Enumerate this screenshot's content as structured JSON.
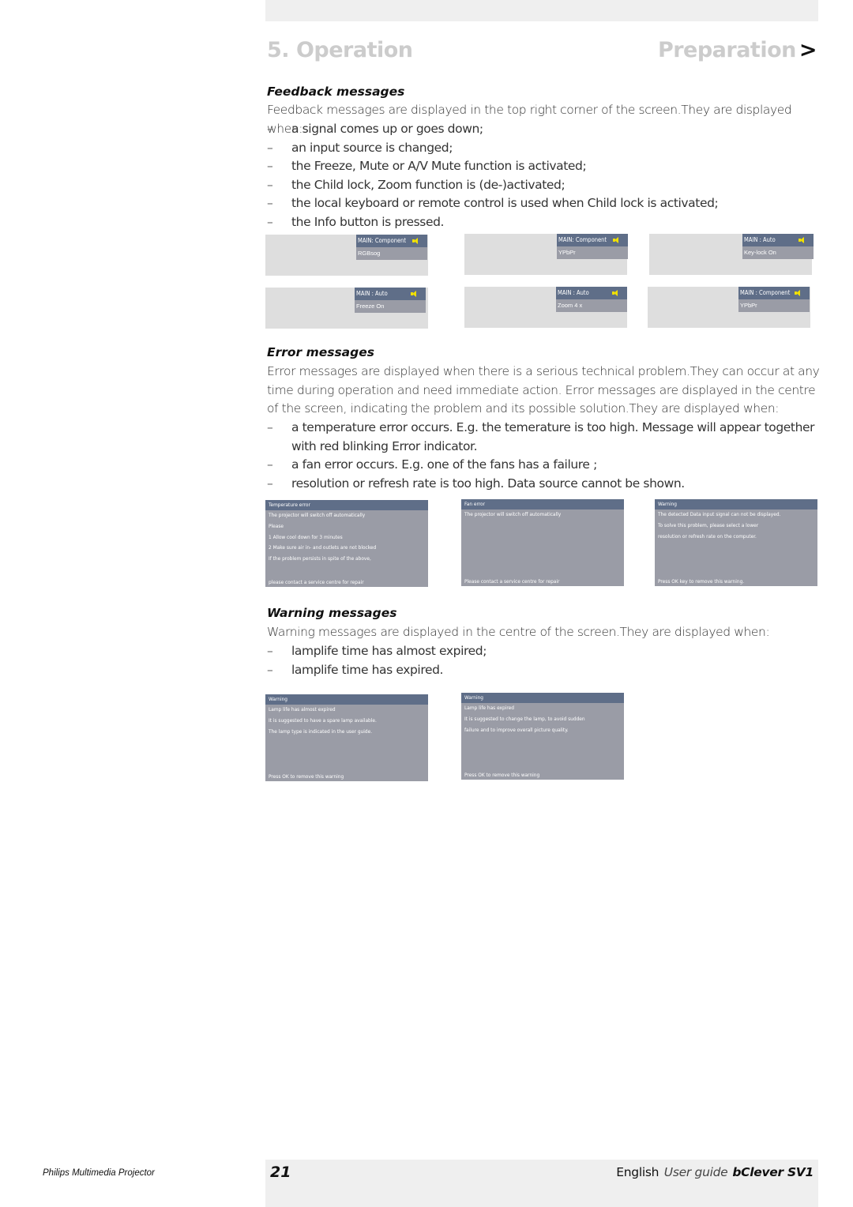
{
  "header": {
    "chapter": "5. Operation",
    "section": "Preparation",
    "section_arrow": ">"
  },
  "feedback": {
    "heading": "Feedback messages",
    "intro": "Feedback messages are displayed in the top right corner of the screen.They are displayed when:",
    "bullet_char": "–",
    "items": [
      "a signal comes up or goes down;",
      "an input source is changed;",
      "the Freeze, Mute or A/V Mute function is activated;",
      "the Child lock, Zoom function is (de-)activated;",
      "the local keyboard or remote control is used when Child lock is activated;",
      "the Info button is pressed."
    ],
    "screens": [
      {
        "title": "MAIN: Component",
        "value": "RGBsog",
        "icon": "speaker-icon"
      },
      {
        "title": "MAIN: Component",
        "value": "YPbPr",
        "icon": "speaker-icon"
      },
      {
        "title": "MAIN : Auto",
        "value": "Key-lock On",
        "icon": "speaker-icon"
      },
      {
        "title": "MAIN : Auto",
        "value": "Freeze On",
        "icon": "speaker-icon"
      },
      {
        "title": "MAIN : Auto",
        "value": "Zoom 4 x",
        "icon": "speaker-icon"
      },
      {
        "title": "MAIN : Component",
        "value": "YPbPr",
        "icon": "speaker-icon"
      }
    ]
  },
  "errors": {
    "heading": "Error messages",
    "intro": "Error messages are displayed when there is a serious technical problem.They can occur at any time during operation and need immediate action. Error messages are displayed in the centre of the screen, indicating the problem and its possible solution.They are displayed when:",
    "bullet_char": "–",
    "items": [
      "a temperature error occurs. E.g. the temerature is too high. Message will appear together with red blinking Error indicator.",
      "a fan error occurs. E.g. one of the fans has a failure ;",
      "resolution or refresh rate is too high. Data source cannot be shown."
    ],
    "dialogs": [
      {
        "title": "Temperature error",
        "lines": [
          "The projector will switch off automatically",
          "Please",
          "1 Allow cool down for 3 minutes",
          "2 Make sure air in- and outlets are not blocked",
          "If the problem persists in spite of the above,"
        ],
        "footer": "please contact a service centre for repair"
      },
      {
        "title": "Fan error",
        "lines": [
          "The projector will switch off automatically"
        ],
        "footer": "Please contact a service centre for repair"
      },
      {
        "title": "Warning",
        "lines": [
          "The detected Data input signal can not be displayed.",
          "To solve this problem, please select a lower",
          "resolution or refresh rate on the computer."
        ],
        "footer": "Press OK key to remove this warning."
      }
    ]
  },
  "warnings": {
    "heading": "Warning messages",
    "intro": "Warning messages are displayed in the centre of the screen.They are displayed when:",
    "bullet_char": "–",
    "items": [
      "lamplife time has almost expired;",
      "lamplife time has expired."
    ],
    "dialogs": [
      {
        "title": "Warning",
        "lines": [
          "Lamp life has almost expired",
          "It is suggested to have a spare lamp available.",
          "The lamp type is indicated in the user guide."
        ],
        "footer": "Press OK to remove this warning"
      },
      {
        "title": "Warning",
        "lines": [
          "Lamp life has expired",
          "It is suggested to change the lamp, to avoid sudden",
          "failure and to improve overall picture quality."
        ],
        "footer": "Press OK to remove this warning"
      }
    ]
  },
  "footer": {
    "product_line": "Philips Multimedia Projector",
    "page_number": "21",
    "language": "English",
    "guide": "User guide",
    "product": "bClever SV1"
  },
  "colors": {
    "osd_title_bar": "#5f6e88",
    "osd_body": "#9a9ca6",
    "screen_bg": "#dedede",
    "speaker_icon": "#f0e000",
    "header_grey": "#cccccc"
  }
}
